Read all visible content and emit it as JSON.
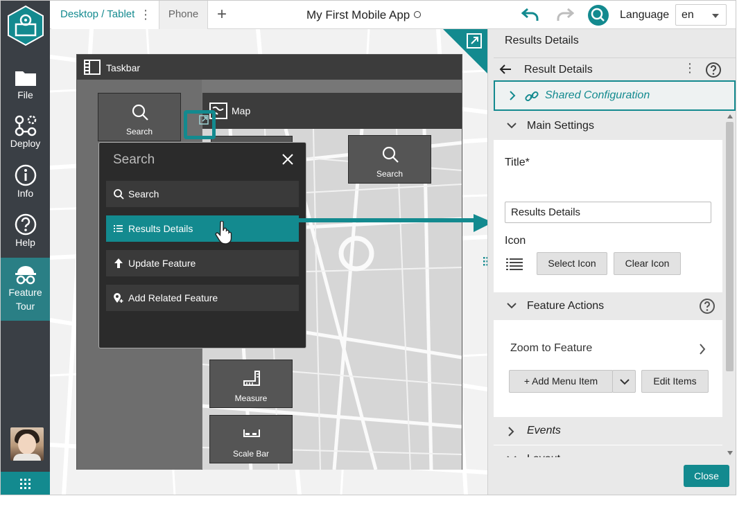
{
  "rail": {
    "items": [
      {
        "label": "File",
        "icon": "folder-icon"
      },
      {
        "label": "Deploy",
        "icon": "deploy-icon"
      },
      {
        "label": "Info",
        "icon": "info-icon"
      },
      {
        "label": "Help",
        "icon": "help-icon"
      },
      {
        "label": "Feature",
        "label2": "Tour",
        "icon": "feature-tour-icon"
      }
    ]
  },
  "topbar": {
    "tab_desktop": "Desktop / Tablet",
    "tab_phone": "Phone",
    "tab_add": "+",
    "app_title": "My First Mobile App",
    "language_label": "Language",
    "language_value": "en"
  },
  "canvas": {
    "taskbar_title": "Taskbar",
    "search_tile_label": "Search",
    "map_title": "Map",
    "map_search_label": "Search",
    "measure_label": "Measure",
    "scalebar_label": "Scale Bar"
  },
  "popup": {
    "placeholder": "Search",
    "items": [
      {
        "label": "Search"
      },
      {
        "label": "Results Details"
      },
      {
        "label": "Update Feature"
      },
      {
        "label": "Add Related Feature"
      }
    ]
  },
  "panel": {
    "title": "Results Details",
    "subtitle": "Result Details",
    "shared_config": "Shared Configuration",
    "main_settings": "Main Settings",
    "title_label": "Title*",
    "title_value": "Results Details",
    "icon_label": "Icon",
    "select_icon": "Select Icon",
    "clear_icon": "Clear Icon",
    "feature_actions": "Feature Actions",
    "zoom_to_feature": "Zoom to Feature",
    "add_menu_item": "+ Add Menu Item",
    "edit_items": "Edit Items",
    "events": "Events",
    "layout": "Layout",
    "close": "Close"
  },
  "colors": {
    "accent": "#138a8f",
    "rail": "#3a3f45",
    "dark_panel": "#2b2b2b"
  }
}
